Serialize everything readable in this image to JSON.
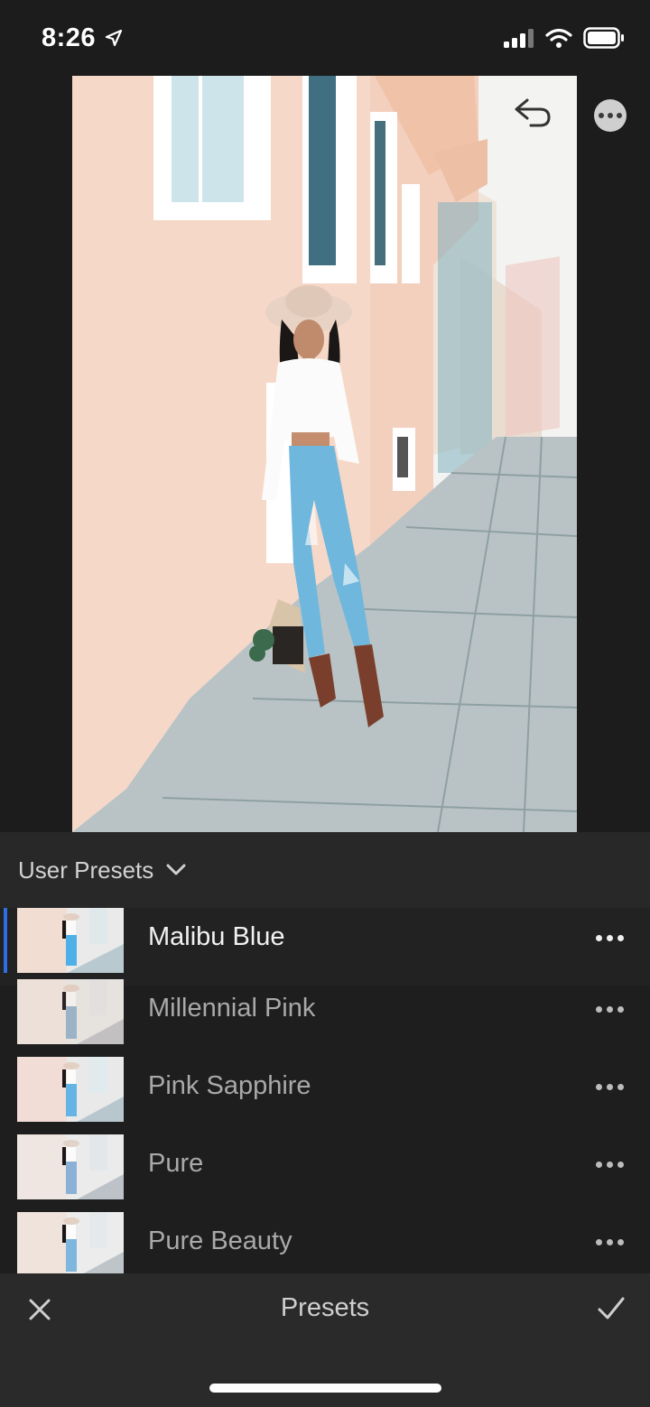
{
  "status_bar": {
    "time": "8:26",
    "location_icon": "location-arrow-icon",
    "signal_icon": "cellular-signal-icon",
    "wifi_icon": "wifi-icon",
    "battery_icon": "battery-icon"
  },
  "photo": {
    "undo_icon": "undo-icon",
    "more_icon": "more-options-icon"
  },
  "preset_group": {
    "label": "User Presets",
    "chevron_icon": "chevron-down-icon"
  },
  "presets": [
    {
      "name": "Malibu Blue",
      "selected": true
    },
    {
      "name": "Millennial Pink",
      "selected": false
    },
    {
      "name": "Pink Sapphire",
      "selected": false
    },
    {
      "name": "Pure",
      "selected": false
    },
    {
      "name": "Pure Beauty",
      "selected": false
    }
  ],
  "bottom_bar": {
    "title": "Presets",
    "cancel_icon": "close-icon",
    "confirm_icon": "checkmark-icon"
  },
  "colors": {
    "background": "#1c1c1c",
    "panel": "#1e1e1e",
    "header": "#282828",
    "accent": "#2d6fe0"
  }
}
